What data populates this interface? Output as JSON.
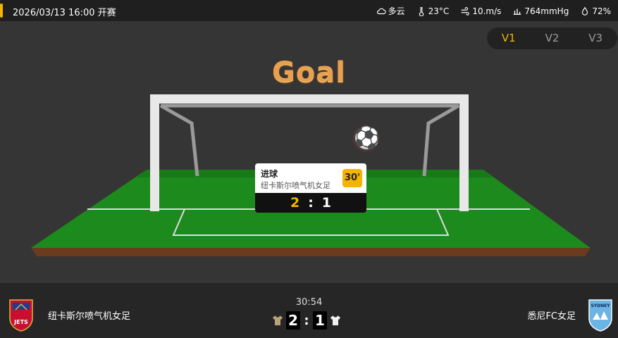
{
  "header": {
    "datetime": "2026/03/13 16:00 开赛",
    "weather": {
      "condition": "多云",
      "temperature": "23°C",
      "wind": "10.m/s",
      "pressure": "764mmHg",
      "humidity": "72%"
    }
  },
  "view_switch": {
    "options": [
      "V1",
      "V2",
      "V3"
    ],
    "active": "V1"
  },
  "event": {
    "title": "Goal",
    "type": "进球",
    "team": "纽卡斯尔喷气机女足",
    "minute": "30'",
    "home_score": "2",
    "separator": ":",
    "away_score": "1"
  },
  "match": {
    "clock": "30:54",
    "home_team": "纽卡斯尔喷气机女足",
    "away_team": "悉尼FC女足",
    "home_score": "2",
    "away_score": "1",
    "separator": ":",
    "home_crest_text": "JETS",
    "away_crest_text": "SYDNEY"
  },
  "colors": {
    "accent": "#f5b400",
    "pitch": "#1c8a1c",
    "background": "#333333"
  }
}
